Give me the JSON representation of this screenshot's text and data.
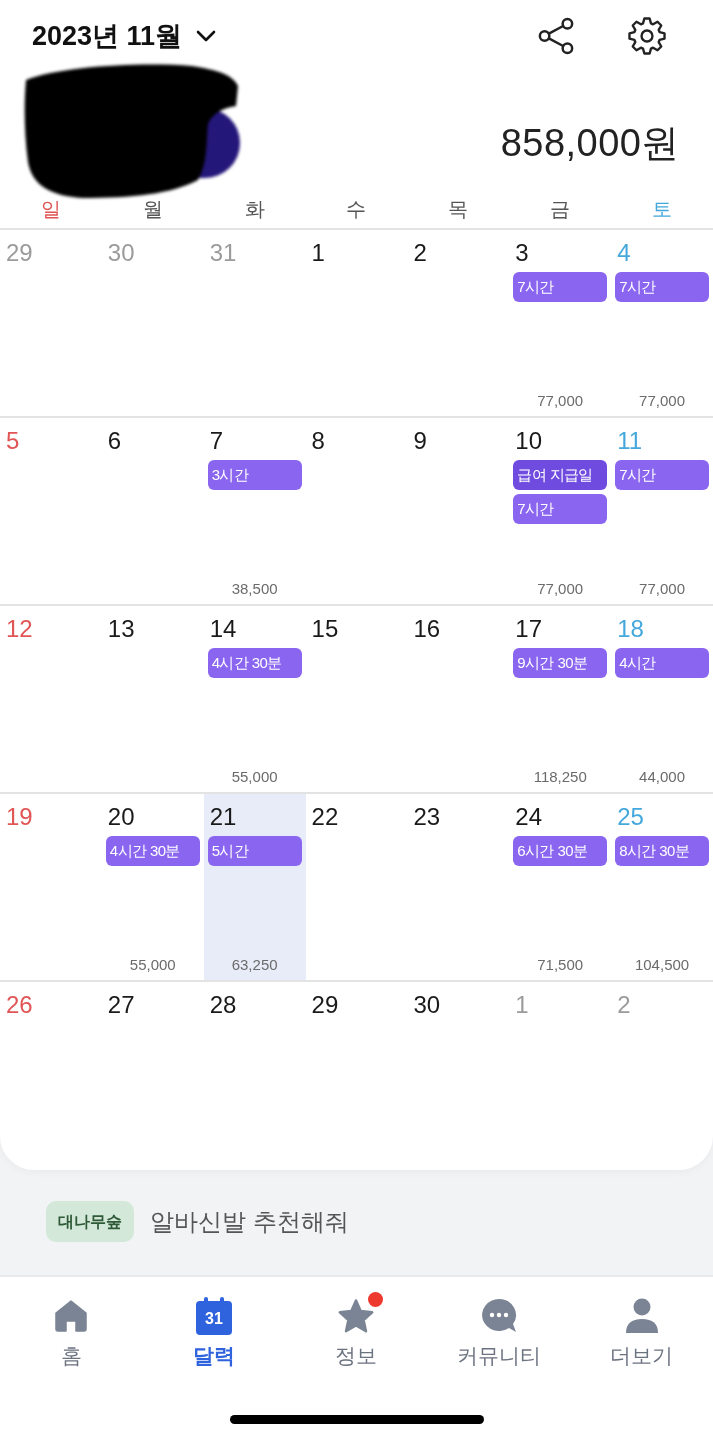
{
  "header": {
    "title": "2023년 11월",
    "total": "858,000원",
    "redacted": true
  },
  "weekdays": [
    "일",
    "월",
    "화",
    "수",
    "목",
    "금",
    "토"
  ],
  "weeks": [
    [
      {
        "date": "29",
        "outside": true,
        "selected": false
      },
      {
        "date": "30",
        "outside": true,
        "selected": false
      },
      {
        "date": "31",
        "outside": true,
        "selected": false
      },
      {
        "date": "1",
        "outside": false,
        "selected": false
      },
      {
        "date": "2",
        "outside": false,
        "selected": false
      },
      {
        "date": "3",
        "outside": false,
        "selected": false,
        "events": [
          {
            "label": "7시간",
            "color": "#8a66f0"
          }
        ],
        "amount": "77,000"
      },
      {
        "date": "4",
        "outside": false,
        "selected": false,
        "events": [
          {
            "label": "7시간",
            "color": "#8a66f0"
          }
        ],
        "amount": "77,000"
      }
    ],
    [
      {
        "date": "5",
        "outside": false,
        "selected": false
      },
      {
        "date": "6",
        "outside": false,
        "selected": false
      },
      {
        "date": "7",
        "outside": false,
        "selected": false,
        "events": [
          {
            "label": "3시간",
            "color": "#8a66f0"
          }
        ],
        "amount": "38,500"
      },
      {
        "date": "8",
        "outside": false,
        "selected": false
      },
      {
        "date": "9",
        "outside": false,
        "selected": false
      },
      {
        "date": "10",
        "outside": false,
        "selected": false,
        "events": [
          {
            "label": "급여 지급일",
            "color": "#6f4be0"
          },
          {
            "label": "7시간",
            "color": "#8a66f0"
          }
        ],
        "amount": "77,000"
      },
      {
        "date": "11",
        "outside": false,
        "selected": false,
        "events": [
          {
            "label": "7시간",
            "color": "#8a66f0"
          }
        ],
        "amount": "77,000"
      }
    ],
    [
      {
        "date": "12",
        "outside": false,
        "selected": false
      },
      {
        "date": "13",
        "outside": false,
        "selected": false
      },
      {
        "date": "14",
        "outside": false,
        "selected": false,
        "events": [
          {
            "label": "4시간 30분",
            "color": "#8a66f0"
          }
        ],
        "amount": "55,000"
      },
      {
        "date": "15",
        "outside": false,
        "selected": false
      },
      {
        "date": "16",
        "outside": false,
        "selected": false
      },
      {
        "date": "17",
        "outside": false,
        "selected": false,
        "events": [
          {
            "label": "9시간 30분",
            "color": "#8a66f0"
          }
        ],
        "amount": "118,250"
      },
      {
        "date": "18",
        "outside": false,
        "selected": false,
        "events": [
          {
            "label": "4시간",
            "color": "#8a66f0"
          }
        ],
        "amount": "44,000"
      }
    ],
    [
      {
        "date": "19",
        "outside": false,
        "selected": false
      },
      {
        "date": "20",
        "outside": false,
        "selected": false,
        "events": [
          {
            "label": "4시간 30분",
            "color": "#8a66f0"
          }
        ],
        "amount": "55,000"
      },
      {
        "date": "21",
        "outside": false,
        "selected": true,
        "events": [
          {
            "label": "5시간",
            "color": "#8a66f0"
          }
        ],
        "amount": "63,250"
      },
      {
        "date": "22",
        "outside": false,
        "selected": false
      },
      {
        "date": "23",
        "outside": false,
        "selected": false
      },
      {
        "date": "24",
        "outside": false,
        "selected": false,
        "events": [
          {
            "label": "6시간 30분",
            "color": "#8a66f0"
          }
        ],
        "amount": "71,500"
      },
      {
        "date": "25",
        "outside": false,
        "selected": false,
        "events": [
          {
            "label": "8시간 30분",
            "color": "#8a66f0"
          }
        ],
        "amount": "104,500"
      }
    ],
    [
      {
        "date": "26",
        "outside": false,
        "selected": false
      },
      {
        "date": "27",
        "outside": false,
        "selected": false
      },
      {
        "date": "28",
        "outside": false,
        "selected": false
      },
      {
        "date": "29",
        "outside": false,
        "selected": false
      },
      {
        "date": "30",
        "outside": false,
        "selected": false
      },
      {
        "date": "1",
        "outside": true,
        "selected": false
      },
      {
        "date": "2",
        "outside": true,
        "selected": false
      }
    ]
  ],
  "banner": {
    "tag": "대나무숲",
    "text": "알바신발 추천해줘"
  },
  "nav": [
    {
      "kind": "home",
      "label": "홈",
      "selected": false,
      "badge": false
    },
    {
      "kind": "calendar",
      "label": "달력",
      "icon_text": "31",
      "selected": true,
      "badge": false
    },
    {
      "kind": "star",
      "label": "정보",
      "selected": false,
      "badge": true
    },
    {
      "kind": "chat",
      "label": "커뮤니티",
      "selected": false,
      "badge": false
    },
    {
      "kind": "person",
      "label": "더보기",
      "selected": false,
      "badge": false
    }
  ]
}
